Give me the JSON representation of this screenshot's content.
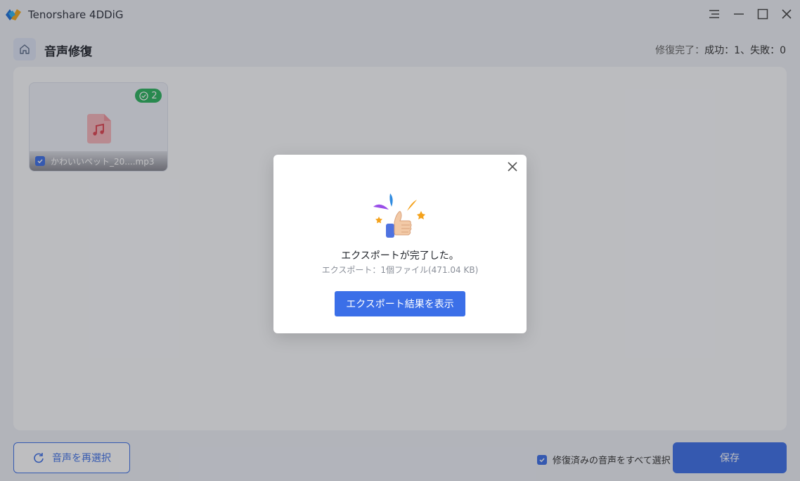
{
  "app": {
    "title": "Tenorshare 4DDiG"
  },
  "window_controls": {
    "menu_icon": "menu-icon",
    "minimize_icon": "minimize-icon",
    "maximize_icon": "maximize-icon",
    "close_icon": "close-icon"
  },
  "header": {
    "home_icon": "home-icon",
    "title": "音声修復",
    "status_label": "修復完了：",
    "status_counts": "成功：1、失敗：0"
  },
  "files": [
    {
      "name": "かわいいペット_20....mp3",
      "badge_count": "2",
      "checked": true,
      "icon": "music-file-icon"
    }
  ],
  "footer": {
    "reselect_label": "音声を再選択",
    "select_all_label": "修復済みの音声をすべて選択",
    "select_all_checked": true,
    "save_label": "保存"
  },
  "modal": {
    "title": "エクスポートが完了した。",
    "subtitle": "エクスポート：1個ファイル(471.04 KB)",
    "button_label": "エクスポート結果を表示",
    "illustration": "thumbs-up-celebration"
  },
  "colors": {
    "accent": "#3b6fe8",
    "success": "#2ab45d",
    "background": "#eef1f7"
  }
}
